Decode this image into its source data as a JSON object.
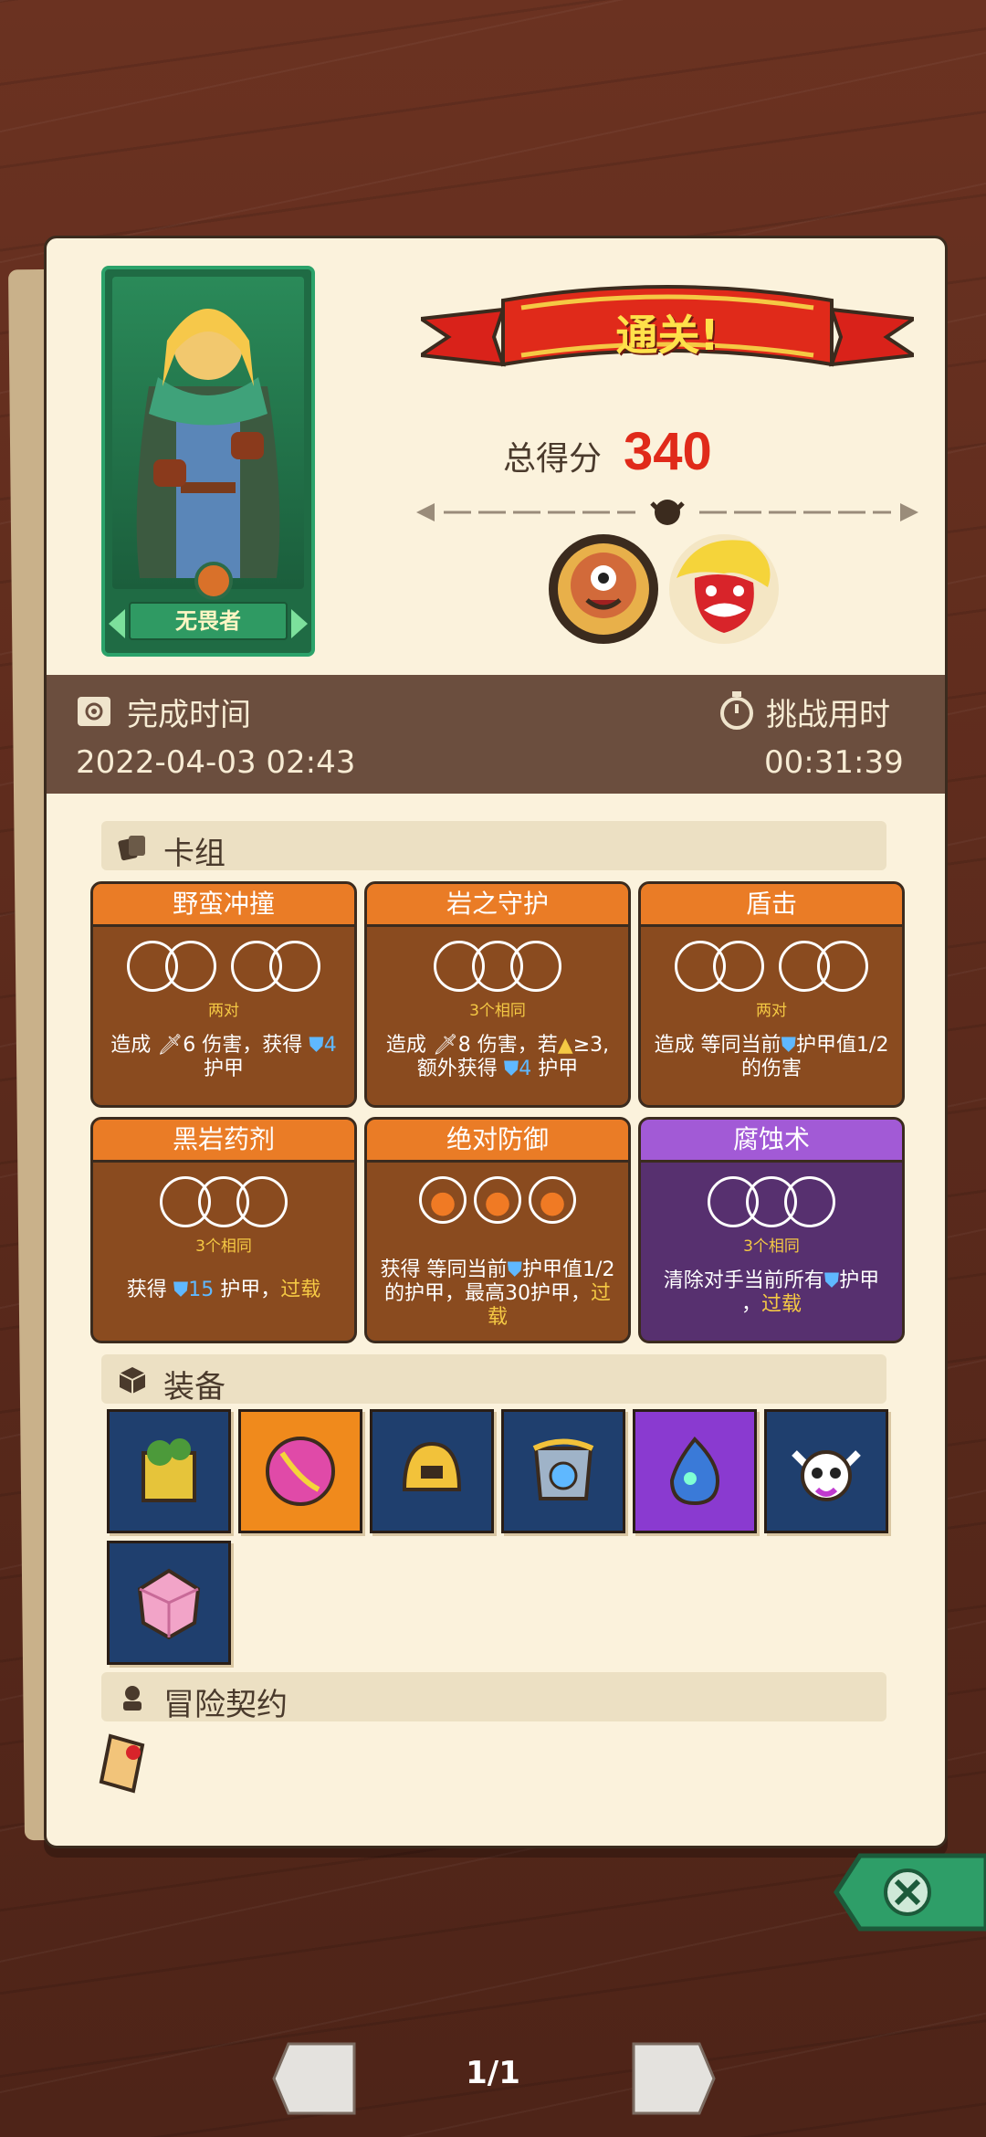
{
  "result": {
    "banner_text": "通关!",
    "score_label": "总得分",
    "score_value": "340"
  },
  "hero": {
    "name": "无畏者"
  },
  "stats": {
    "finish_label": "完成时间",
    "finish_value": "2022-04-03 02:43",
    "duration_label": "挑战用时",
    "duration_value": "00:31:39"
  },
  "deck": {
    "title": "卡组",
    "cards": [
      {
        "name": "野蛮冲撞",
        "req": "两对",
        "desc_a": "造成 ",
        "dmg": "6",
        "desc_b": " 伤害，获得 ",
        "armor": "4",
        "desc_c": "护甲",
        "style": "orange"
      },
      {
        "name": "岩之守护",
        "req": "3个相同",
        "desc_a": "造成 ",
        "dmg": "8",
        "desc_b": " 伤害，若",
        "cond": "≥3,",
        "desc_c": "额外获得 ",
        "armor": "4",
        "desc_d": " 护甲",
        "style": "orange"
      },
      {
        "name": "盾击",
        "req": "两对",
        "desc_a": "造成 等同当前",
        "desc_b": "护甲值1/2",
        "desc_c": "的伤害",
        "style": "orange"
      },
      {
        "name": "黑岩药剂",
        "req": "3个相同",
        "desc_a": "获得 ",
        "armor": "15",
        "desc_b": " 护甲，",
        "kw": "过载",
        "style": "orange"
      },
      {
        "name": "绝对防御",
        "req": "",
        "desc_a": "获得 等同当前",
        "desc_b": "护甲值1/2",
        "desc_c": "的护甲，最高30护甲，",
        "kw": "过载",
        "style": "orange"
      },
      {
        "name": "腐蚀术",
        "req": "3个相同",
        "desc_a": "清除对手当前所有",
        "desc_b": "护甲",
        "desc_c": "，",
        "kw": "过载",
        "style": "purple"
      }
    ]
  },
  "equipment": {
    "title": "装备",
    "items": [
      {
        "icon": "moss-cube-icon",
        "bg": "#1f3f6e"
      },
      {
        "icon": "fire-orb-icon",
        "bg": "#f08a1c"
      },
      {
        "icon": "golden-helmet-icon",
        "bg": "#1f3f6e"
      },
      {
        "icon": "compass-armor-icon",
        "bg": "#1f3f6e"
      },
      {
        "icon": "blue-flame-spirit-icon",
        "bg": "#8a3ad0"
      },
      {
        "icon": "horned-skull-icon",
        "bg": "#1f3f6e"
      },
      {
        "icon": "pink-crystal-dice-icon",
        "bg": "#1f3f6e"
      }
    ]
  },
  "contract": {
    "title": "冒险契约",
    "icon": "scroll-icon"
  },
  "pager": {
    "text": "1/1"
  },
  "colors": {
    "accent_red": "#e02a1a",
    "orange_card": "#ea7c26",
    "purple_card": "#a25ad6",
    "hero_green": "#1f6b44"
  }
}
